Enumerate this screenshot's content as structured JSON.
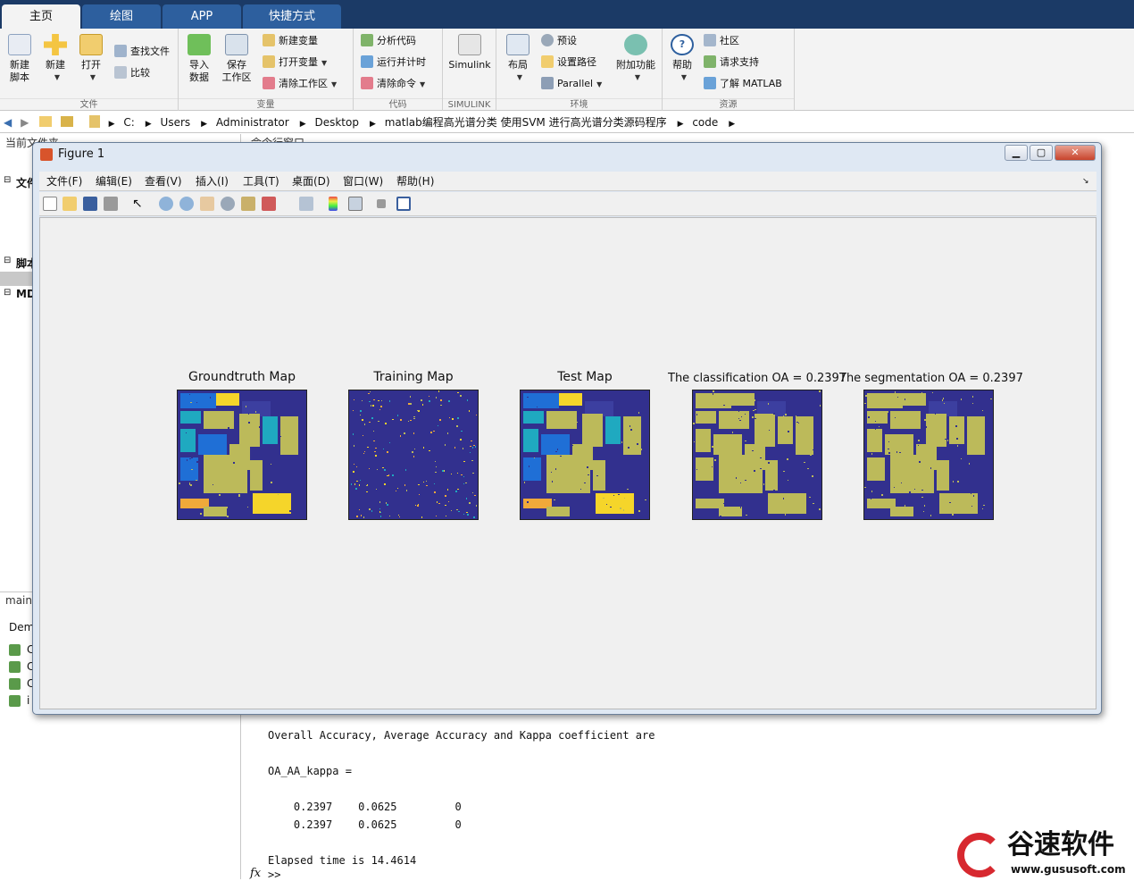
{
  "tabs": [
    "主页",
    "绘图",
    "APP",
    "快捷方式"
  ],
  "ribbon": {
    "file_group": {
      "title": "文件",
      "new_script": "新建\n脚本",
      "new": "新建",
      "open": "打开",
      "find_files": "查找文件",
      "compare": "比较"
    },
    "var_group": {
      "title": "变量",
      "import": "导入\n数据",
      "save_ws": "保存\n工作区",
      "new_var": "新建变量",
      "open_var": "打开变量",
      "clear_ws": "清除工作区"
    },
    "code_group": {
      "title": "代码",
      "analyze": "分析代码",
      "run_time": "运行并计时",
      "clear_cmd": "清除命令"
    },
    "simulink_group": {
      "title": "SIMULINK",
      "simulink": "Simulink"
    },
    "env_group": {
      "title": "环境",
      "layout": "布局",
      "prefs": "预设",
      "set_path": "设置路径",
      "parallel": "Parallel",
      "addons": "附加功能"
    },
    "res_group": {
      "title": "资源",
      "help": "帮助",
      "community": "社区",
      "support": "请求支持",
      "learn": "了解 MATLAB"
    }
  },
  "address": [
    "C:",
    "Users",
    "Administrator",
    "Desktop",
    "matlab编程高光谱分类 使用SVM 进行高光谱分类源码程序",
    "code"
  ],
  "left_panel": {
    "header": "当前文件夹",
    "tree": [
      "文件",
      "脚本",
      "MD"
    ],
    "bottom_label": "main.",
    "demo_label": "Dem",
    "file_prefixes": [
      "C",
      "C",
      "C",
      "i"
    ]
  },
  "cmd": {
    "header": "命令行窗口",
    "line1": "Overall Accuracy, Average Accuracy and Kappa coefficient are",
    "line2": "OA_AA_kappa =",
    "row1": "    0.2397    0.0625         0",
    "row2": "    0.2397    0.0625         0",
    "line3": "Elapsed time is 14.4614",
    "prompt": ">>",
    "fx": "fx"
  },
  "figure": {
    "title": "Figure 1",
    "menu": [
      "文件(F)",
      "编辑(E)",
      "查看(V)",
      "插入(I)",
      "工具(T)",
      "桌面(D)",
      "窗口(W)",
      "帮助(H)"
    ],
    "maps": [
      {
        "title": "Groundtruth Map",
        "style": "gt"
      },
      {
        "title": "Training Map",
        "style": "train"
      },
      {
        "title": "Test Map",
        "style": "gt"
      },
      {
        "title": "The classification OA = 0.2397",
        "style": "cls"
      },
      {
        "title": "The segmentation OA = 0.2397",
        "style": "cls"
      }
    ]
  },
  "logo": {
    "name": "谷速软件",
    "url": "www.gususoft.com"
  },
  "colors": {
    "navy": "#32308e",
    "olive": "#bcba5a",
    "teal": "#1fa9c0",
    "blue": "#1f6fd6",
    "yellow": "#f5d52a",
    "orange": "#f0a93a"
  }
}
